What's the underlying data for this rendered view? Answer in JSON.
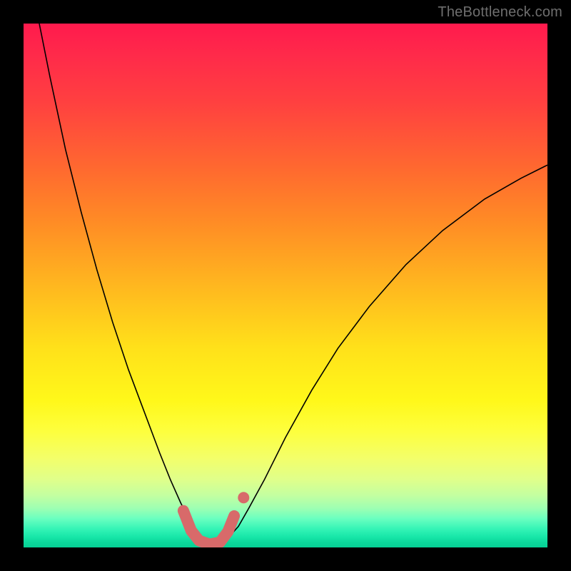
{
  "watermark": "TheBottleneck.com",
  "chart_data": {
    "type": "line",
    "title": "",
    "xlabel": "",
    "ylabel": "",
    "xlim": [
      0,
      100
    ],
    "ylim": [
      0,
      100
    ],
    "grid": false,
    "legend": false,
    "annotations": [],
    "gradient_stops": [
      {
        "pos": 0,
        "color": "#ff1a4d"
      },
      {
        "pos": 15,
        "color": "#ff4040"
      },
      {
        "pos": 38,
        "color": "#ff8c25"
      },
      {
        "pos": 62,
        "color": "#ffe11a"
      },
      {
        "pos": 83,
        "color": "#f3ff6a"
      },
      {
        "pos": 96.5,
        "color": "#34f4b6"
      },
      {
        "pos": 100,
        "color": "#06d095"
      }
    ],
    "series": [
      {
        "name": "bottleneck-curve",
        "stroke": "#000000",
        "stroke_width": 1.6,
        "x": [
          3.0,
          5.0,
          8.0,
          11.0,
          14.0,
          17.0,
          20.0,
          23.0,
          26.0,
          28.0,
          30.0,
          31.5,
          33.0,
          34.5,
          36.0,
          37.5,
          39.0,
          41.0,
          43.0,
          46.0,
          50.0,
          55.0,
          60.0,
          66.0,
          73.0,
          80.0,
          88.0,
          95.0,
          100.0
        ],
        "y": [
          100.0,
          90.0,
          76.0,
          64.0,
          53.0,
          43.0,
          34.0,
          26.0,
          18.0,
          13.0,
          8.5,
          5.5,
          3.0,
          1.5,
          0.5,
          0.7,
          1.8,
          4.0,
          7.5,
          13.0,
          21.0,
          30.0,
          38.0,
          46.0,
          54.0,
          60.5,
          66.5,
          70.5,
          73.0
        ]
      },
      {
        "name": "optimal-marker",
        "stroke": "#d86a6a",
        "stroke_width": 16,
        "linecap": "round",
        "x": [
          30.5,
          32.0,
          33.5,
          35.5,
          37.5,
          39.0,
          40.2
        ],
        "y": [
          7.0,
          3.2,
          1.3,
          0.6,
          1.0,
          3.0,
          6.0
        ]
      },
      {
        "name": "optimal-marker-dot",
        "type": "scatter",
        "color": "#d86a6a",
        "radius": 8,
        "x": [
          42.0
        ],
        "y": [
          9.5
        ]
      }
    ]
  }
}
